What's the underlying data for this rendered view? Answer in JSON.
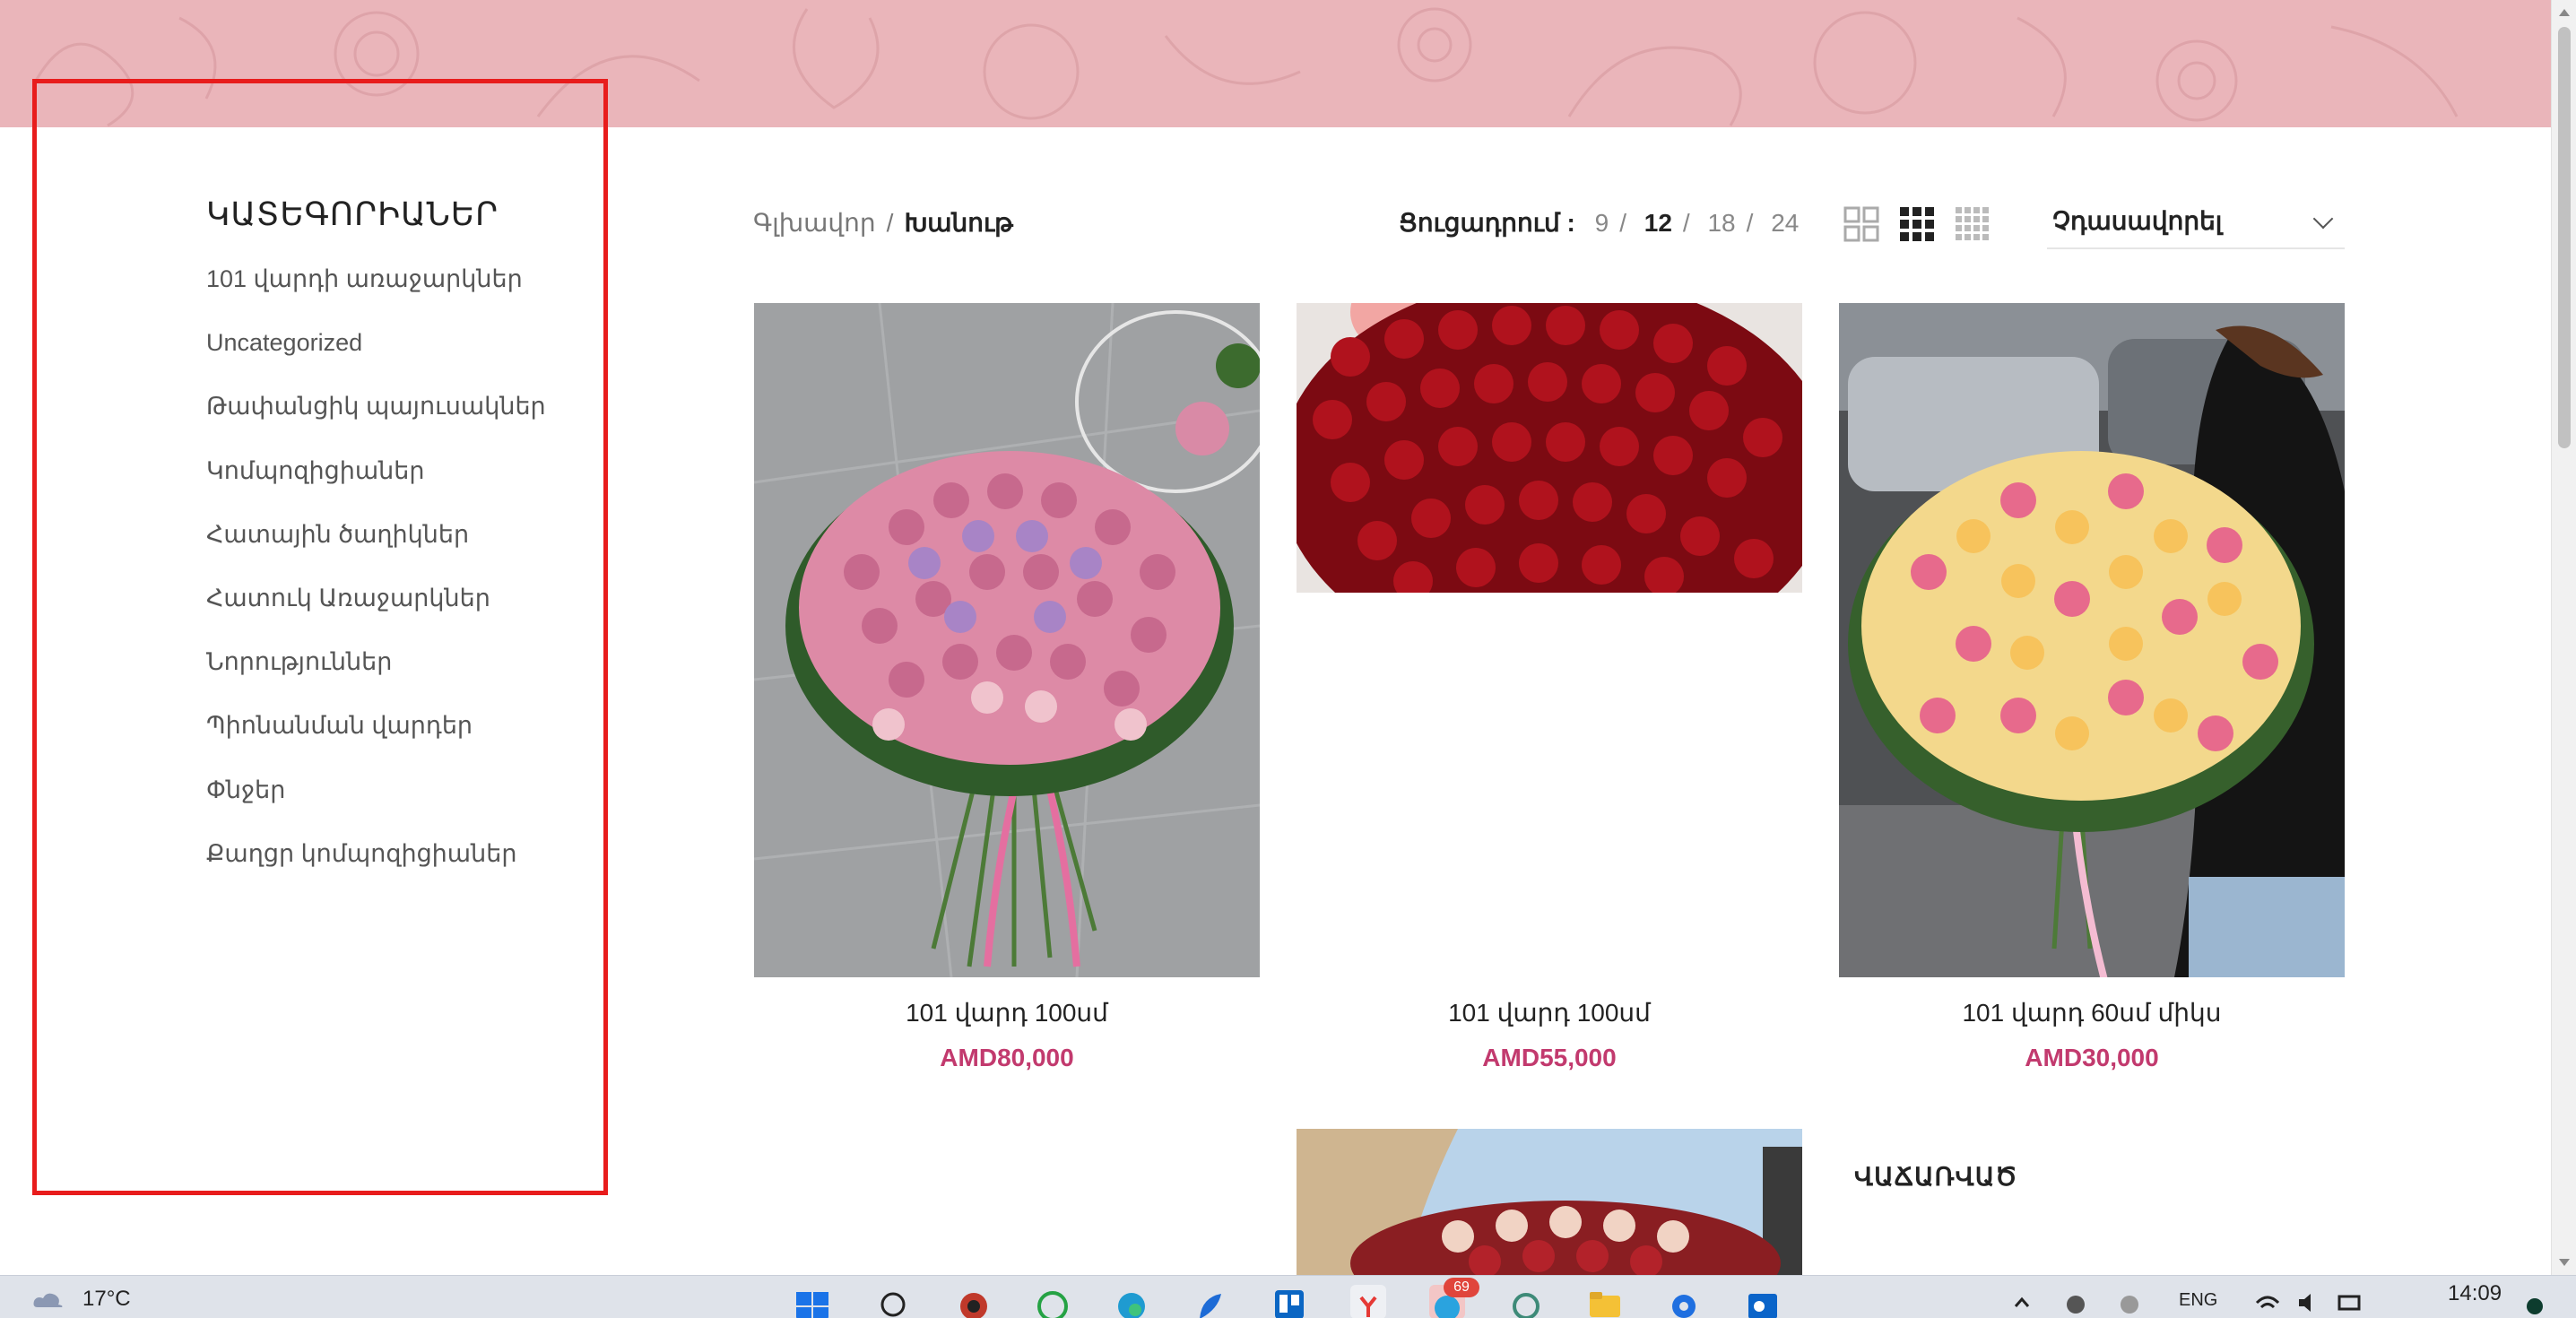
{
  "sidebar": {
    "title": "ԿԱՏԵԳՈՐԻԱՆԵՐ",
    "items": [
      {
        "label": "101 վարդի առաջարկներ"
      },
      {
        "label": "Uncategorized"
      },
      {
        "label": "Թափանցիկ պայուսակներ"
      },
      {
        "label": "Կոմպոզիցիաներ"
      },
      {
        "label": "Հատային ծաղիկներ"
      },
      {
        "label": "Հատուկ Առաջարկներ"
      },
      {
        "label": "Նորություններ"
      },
      {
        "label": "Պիոնանման վարդեր"
      },
      {
        "label": "Փնջեր"
      },
      {
        "label": "Քաղցր կոմպոզիցիաներ"
      }
    ]
  },
  "breadcrumb": {
    "home": "Գլխավոր",
    "separator": "/",
    "current": "Խանութ"
  },
  "per_page": {
    "label": "Ցուցադրում :",
    "separator": "/",
    "options": [
      "9",
      "12",
      "18",
      "24"
    ],
    "active": "12"
  },
  "view_modes": [
    {
      "icon": "grid-2-icon",
      "active": false
    },
    {
      "icon": "grid-3-icon",
      "active": true
    },
    {
      "icon": "grid-4-icon",
      "active": false
    }
  ],
  "sort": {
    "selected": "Չդասավորել"
  },
  "products": [
    {
      "name": "101 վարդ 100սմ",
      "price": "AMD80,000",
      "image": "pink-purple-rose-bouquet"
    },
    {
      "name": "101 վարդ 100սմ",
      "price": "AMD55,000",
      "image": "red-rose-bouquet"
    },
    {
      "name": "101 վարդ 60սմ միկս",
      "price": "AMD30,000",
      "image": "yellow-pink-rose-bouquet"
    }
  ],
  "soldout_label": "ՎԱՃԱՌՎԱԾ",
  "colors": {
    "header_band": "#eab5ba",
    "price": "#c23a6e",
    "highlight": "#e81c1c"
  },
  "taskbar": {
    "weather": "17°C",
    "badge": "69",
    "lang": "ENG",
    "time": "14:09"
  }
}
